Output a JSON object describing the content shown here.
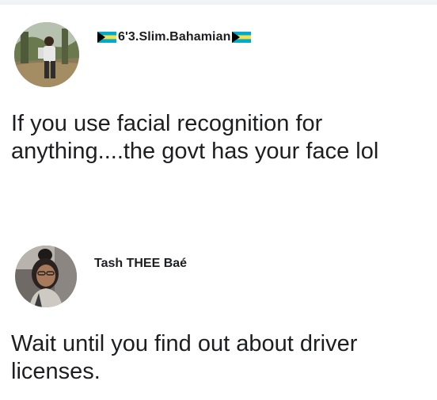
{
  "posts": [
    {
      "author": "6'3.Slim.Bahamian",
      "author_flags": [
        "bahamas-flag-icon",
        "bahamas-flag-icon"
      ],
      "text": "If you use facial recognition for anything....the govt has your face lol"
    },
    {
      "author": "Tash THEE Baé",
      "text": "Wait until you find out about driver licenses."
    }
  ],
  "colors": {
    "text": "#1c1e21",
    "flag_aquamarine": "#00abc9",
    "flag_gold": "#fae042",
    "flag_black": "#000000"
  }
}
